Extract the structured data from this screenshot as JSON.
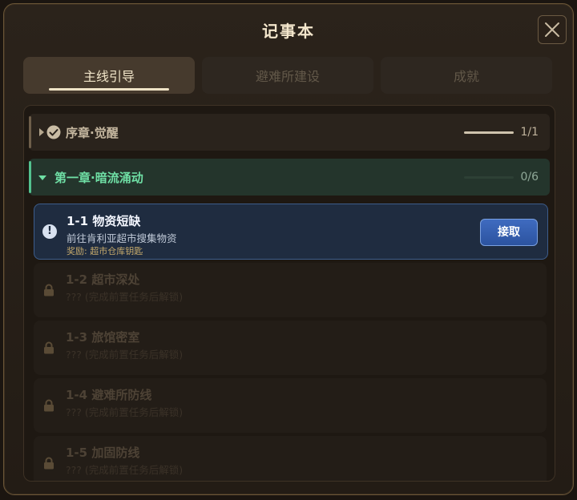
{
  "window": {
    "title": "记事本"
  },
  "tabs": [
    {
      "label": "主线引导",
      "active": true
    },
    {
      "label": "避难所建设",
      "active": false
    },
    {
      "label": "成就",
      "active": false
    }
  ],
  "chapters": [
    {
      "title": "序章·觉醒",
      "progress_text": "1/1",
      "progress": 1.0,
      "completed": true,
      "expanded": false
    },
    {
      "title": "第一章·暗流涌动",
      "progress_text": "0/6",
      "progress": 0.0,
      "completed": false,
      "expanded": true
    }
  ],
  "quests": [
    {
      "title": "1-1 物资短缺",
      "desc": "前往肯利亚超市搜集物资",
      "reward": "奖励: 超市仓库钥匙",
      "status": "available",
      "button": "接取"
    },
    {
      "title": "1-2 超市深处",
      "desc": "??? (完成前置任务后解锁)",
      "status": "locked"
    },
    {
      "title": "1-3 旅馆密室",
      "desc": "??? (完成前置任务后解锁)",
      "status": "locked"
    },
    {
      "title": "1-4 避难所防线",
      "desc": "??? (完成前置任务后解锁)",
      "status": "locked"
    },
    {
      "title": "1-5 加固防线",
      "desc": "??? (完成前置任务后解锁)",
      "status": "locked"
    }
  ],
  "colors": {
    "panel_bg": "#2b231b",
    "chapter_active": "#53c28f",
    "quest_active_bg": "#1f2c40",
    "button_blue": "#3f6bc0"
  },
  "icons": {
    "close": "close-icon",
    "completed": "checkmark-icon",
    "collapsed": "triangle-right-icon",
    "expanded": "triangle-down-icon",
    "alert": "exclamation-icon",
    "locked": "lock-icon"
  }
}
